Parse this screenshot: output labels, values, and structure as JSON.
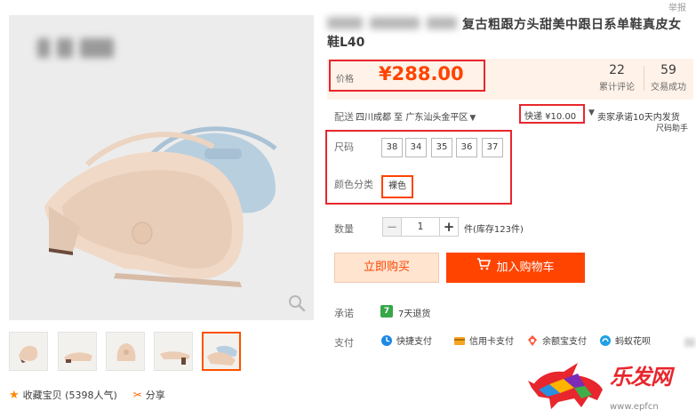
{
  "title": {
    "line1": "复古粗跟方头甜美中跟日系单鞋真皮女",
    "line2": "鞋L40"
  },
  "top_right_fragment": "举报",
  "price": {
    "label": "价格",
    "value": "¥288.00"
  },
  "stats": [
    {
      "num": "22",
      "label": "累计评论"
    },
    {
      "num": "59",
      "label": "交易成功"
    }
  ],
  "shipping": {
    "label": "配送",
    "route": "四川成都 至 广东汕头金平区",
    "fee": "快递 ¥10.00",
    "promise": "卖家承诺10天内发货",
    "size_helper": "尺码助手"
  },
  "sku": {
    "size_label": "尺码",
    "sizes": [
      "38",
      "34",
      "35",
      "36",
      "37"
    ],
    "color_label": "颜色分类",
    "color_option": "裸色"
  },
  "quantity": {
    "label": "数量",
    "minus": "−",
    "value": "1",
    "plus": "+",
    "stock": "件(库存123件)"
  },
  "actions": {
    "buy_now": "立即购买",
    "add_cart": "加入购物车"
  },
  "promise": {
    "label": "承诺",
    "icon_text": "7",
    "text": "7天退货"
  },
  "payment": {
    "label": "支付",
    "methods": [
      "快捷支付",
      "信用卡支付",
      "余额宝支付",
      "蚂蚁花呗"
    ]
  },
  "favorites": {
    "text": "收藏宝贝 (5398人气)",
    "share": "分享"
  },
  "watermark": {
    "text": "乐发网",
    "url": "www.epfcn"
  },
  "colors": {
    "accent": "#ff4400",
    "highlight_box": "#e8262d",
    "price_bg": "#fff2e8"
  }
}
